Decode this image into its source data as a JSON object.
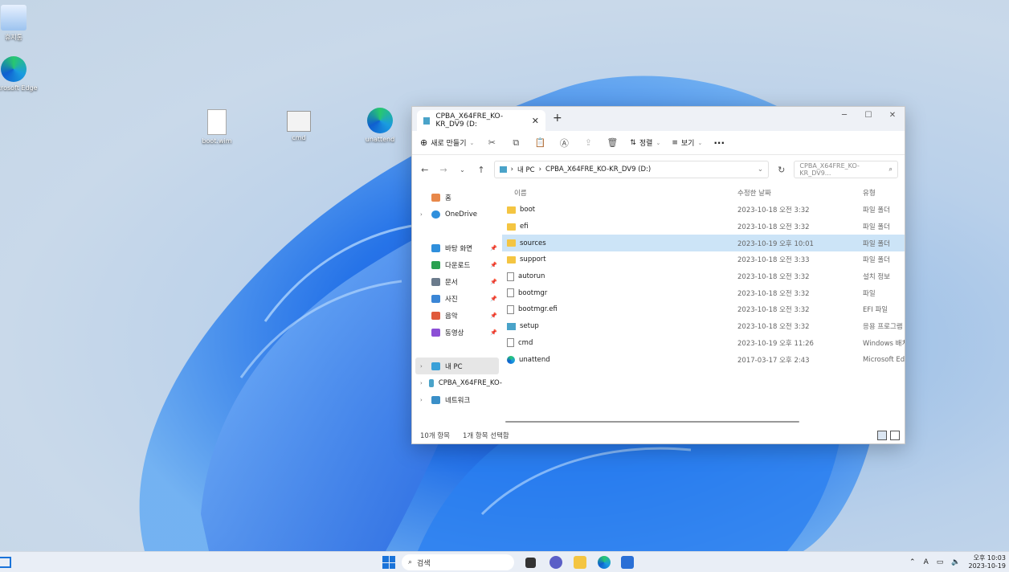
{
  "desktop": {
    "icons": [
      {
        "label": "휴지통",
        "name": "recycle-bin-icon"
      },
      {
        "label": "Microsoft Edge",
        "name": "edge-icon"
      },
      {
        "label": "boot.wim",
        "name": "file-icon"
      },
      {
        "label": "cmd",
        "name": "cmd-icon"
      },
      {
        "label": "unattend",
        "name": "edge-icon"
      }
    ]
  },
  "window": {
    "tab_title": "CPBA_X64FRE_KO-KR_DV9 (D:",
    "toolbar": {
      "new_label": "새로 만들기",
      "sort_label": "정렬",
      "view_label": "보기",
      "more_label": "···"
    },
    "address": {
      "root": "내 PC",
      "current": "CPBA_X64FRE_KO-KR_DV9 (D:)"
    },
    "search_placeholder": "CPBA_X64FRE_KO-KR_DV9...",
    "nav": {
      "home": "홈",
      "onedrive": "OneDrive",
      "quick": [
        {
          "label": "바탕 화면",
          "color": "#2f8fdc"
        },
        {
          "label": "다운로드",
          "color": "#2aa150"
        },
        {
          "label": "문서",
          "color": "#6b7b8c"
        },
        {
          "label": "사진",
          "color": "#3b86d6"
        },
        {
          "label": "음악",
          "color": "#e05a3c"
        },
        {
          "label": "동영상",
          "color": "#8c4fd6"
        }
      ],
      "this_pc": "내 PC",
      "drive": "CPBA_X64FRE_KO-",
      "network": "네트워크"
    },
    "columns": {
      "name": "이름",
      "date": "수정한 날짜",
      "type": "유형"
    },
    "files": [
      {
        "name": "boot",
        "date": "2023-10-18 오전 3:32",
        "type": "파일 폴더",
        "kind": "folder"
      },
      {
        "name": "efi",
        "date": "2023-10-18 오전 3:32",
        "type": "파일 폴더",
        "kind": "folder"
      },
      {
        "name": "sources",
        "date": "2023-10-19 오후 10:01",
        "type": "파일 폴더",
        "kind": "folder"
      },
      {
        "name": "support",
        "date": "2023-10-18 오전 3:33",
        "type": "파일 폴더",
        "kind": "folder"
      },
      {
        "name": "autorun",
        "date": "2023-10-18 오전 3:32",
        "type": "설치 정보",
        "kind": "doc"
      },
      {
        "name": "bootmgr",
        "date": "2023-10-18 오전 3:32",
        "type": "파일",
        "kind": "doc"
      },
      {
        "name": "bootmgr.efi",
        "date": "2023-10-18 오전 3:32",
        "type": "EFI 파일",
        "kind": "doc"
      },
      {
        "name": "setup",
        "date": "2023-10-18 오전 3:32",
        "type": "응용 프로그램",
        "kind": "app"
      },
      {
        "name": "cmd",
        "date": "2023-10-19 오후 11:26",
        "type": "Windows 배치",
        "kind": "doc"
      },
      {
        "name": "unattend",
        "date": "2017-03-17 오후 2:43",
        "type": "Microsoft Edge",
        "kind": "edge"
      }
    ],
    "status": {
      "count": "10개 항목",
      "selected": "1개 항목 선택함"
    }
  },
  "taskbar": {
    "search_label": "검색",
    "clock_time": "오후 10:03",
    "clock_date": "2023-10-19",
    "ime": "A"
  }
}
